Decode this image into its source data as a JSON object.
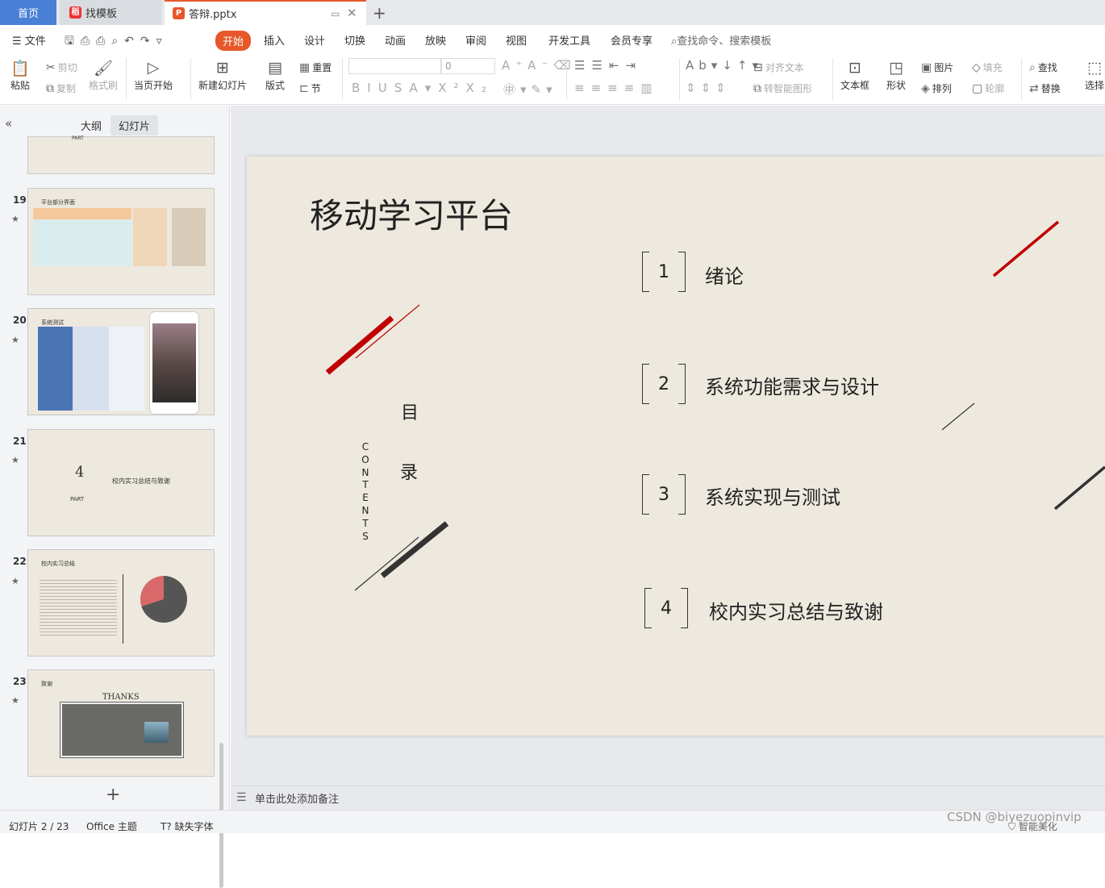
{
  "tabs": {
    "home": "首页",
    "template": "找模板",
    "file": "答辩.pptx",
    "new_tab": "+"
  },
  "menu": {
    "file": "文件",
    "start": "开始",
    "insert": "插入",
    "design": "设计",
    "switch": "切换",
    "animation": "动画",
    "slideshow": "放映",
    "review": "审阅",
    "view": "视图",
    "dev": "开发工具",
    "member": "会员专享",
    "search": "查找命令、搜索模板"
  },
  "ribbon": {
    "paste": "粘贴",
    "cut": "剪切",
    "copy": "复制",
    "format_painter": "格式刷",
    "from_start": "当页开始",
    "new_slide": "新建幻灯片",
    "layout": "版式",
    "reset": "重置",
    "section": "节",
    "font_size": "0",
    "align_text": "对齐文本",
    "smart_shape": "转智能图形",
    "textbox": "文本框",
    "shape": "形状",
    "picture": "图片",
    "arrange": "排列",
    "fill": "填充",
    "outline": "轮廓",
    "find": "查找",
    "replace": "替换",
    "select": "选择"
  },
  "left_panel": {
    "outline": "大纲",
    "slides": "幻灯片",
    "add": "+",
    "thumbs": [
      {
        "num": "19",
        "title": "平台部分界面"
      },
      {
        "num": "20",
        "title": "系统测试"
      },
      {
        "num": "21",
        "part": "4",
        "part_label": "PART",
        "title": "校内实习总结与致谢"
      },
      {
        "num": "22",
        "title": "校内实习总结"
      },
      {
        "num": "23",
        "title": "致谢",
        "thanks": "THANKS"
      }
    ],
    "top_part": "PART"
  },
  "slide": {
    "title": "移动学习平台",
    "mulu1": "目",
    "mulu2": "录",
    "contents": "CONTENTS",
    "items": [
      {
        "num": "1",
        "text": "绪论"
      },
      {
        "num": "2",
        "text": "系统功能需求与设计"
      },
      {
        "num": "3",
        "text": "系统实现与测试"
      },
      {
        "num": "4",
        "text": "校内实习总结与致谢"
      }
    ]
  },
  "notes": "单击此处添加备注",
  "status": {
    "slide_index": "幻灯片 2 / 23",
    "theme": "Office 主题",
    "missing_font": "缺失字体",
    "beautify": "智能美化"
  },
  "watermark": "CSDN @biyezuopinvip"
}
